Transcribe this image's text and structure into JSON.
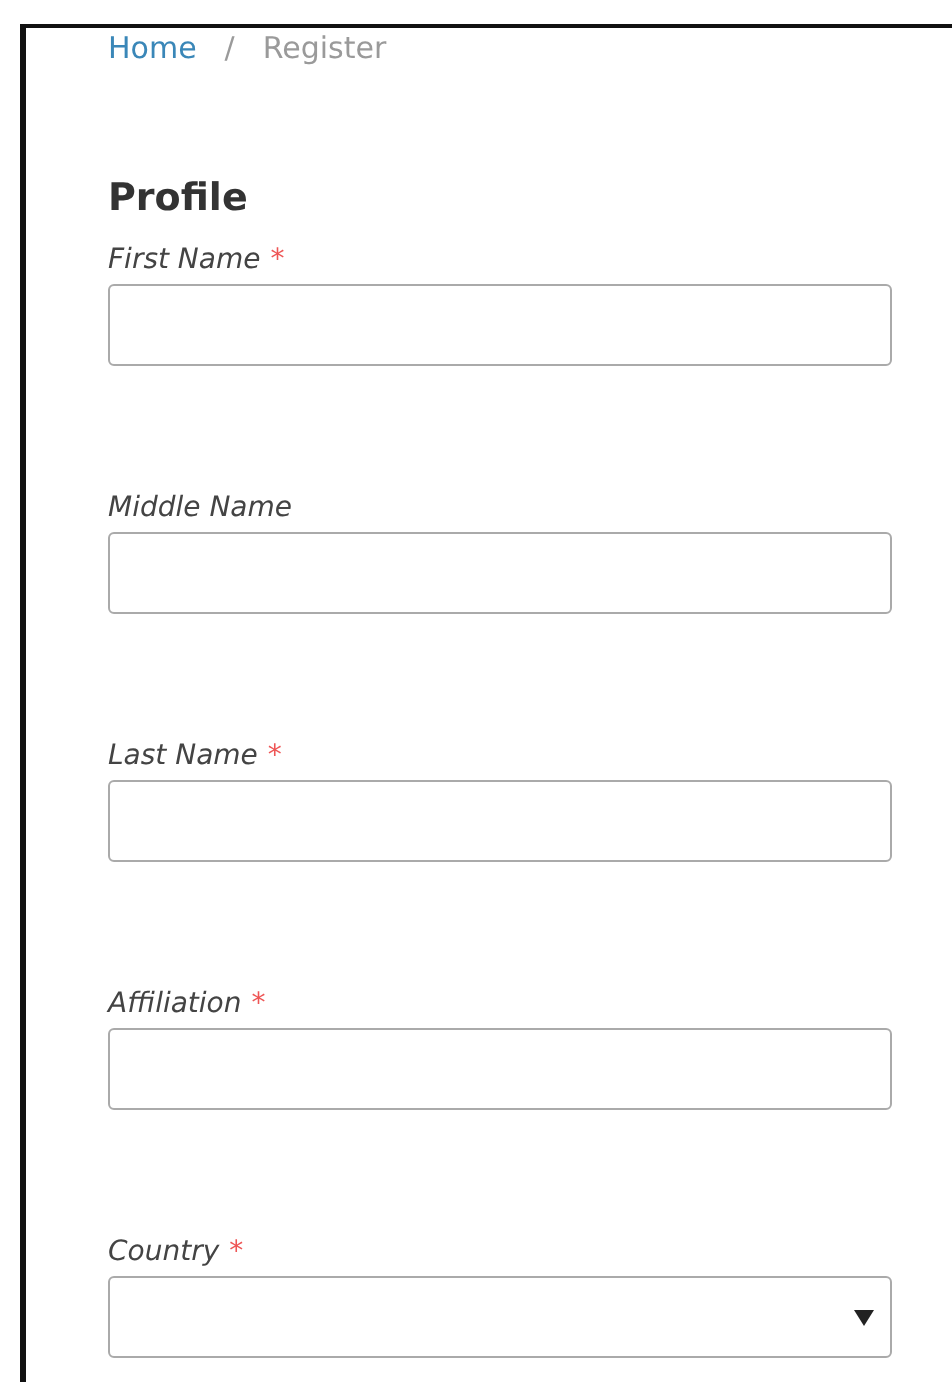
{
  "breadcrumb": [
    {
      "label": "Home",
      "kind": "link"
    },
    {
      "label": "Register",
      "kind": "current"
    }
  ],
  "breadcrumb_separator": "/",
  "heading": "Profile",
  "fields": [
    {
      "label": "First Name",
      "required_mark": "*",
      "kind": "text"
    },
    {
      "label": "Middle Name",
      "kind": "text"
    },
    {
      "label": "Last Name",
      "required_mark": "*",
      "kind": "text"
    },
    {
      "label": "Affiliation",
      "required_mark": "*",
      "kind": "text"
    },
    {
      "label": "Country",
      "required_mark": "*",
      "kind": "select"
    }
  ]
}
